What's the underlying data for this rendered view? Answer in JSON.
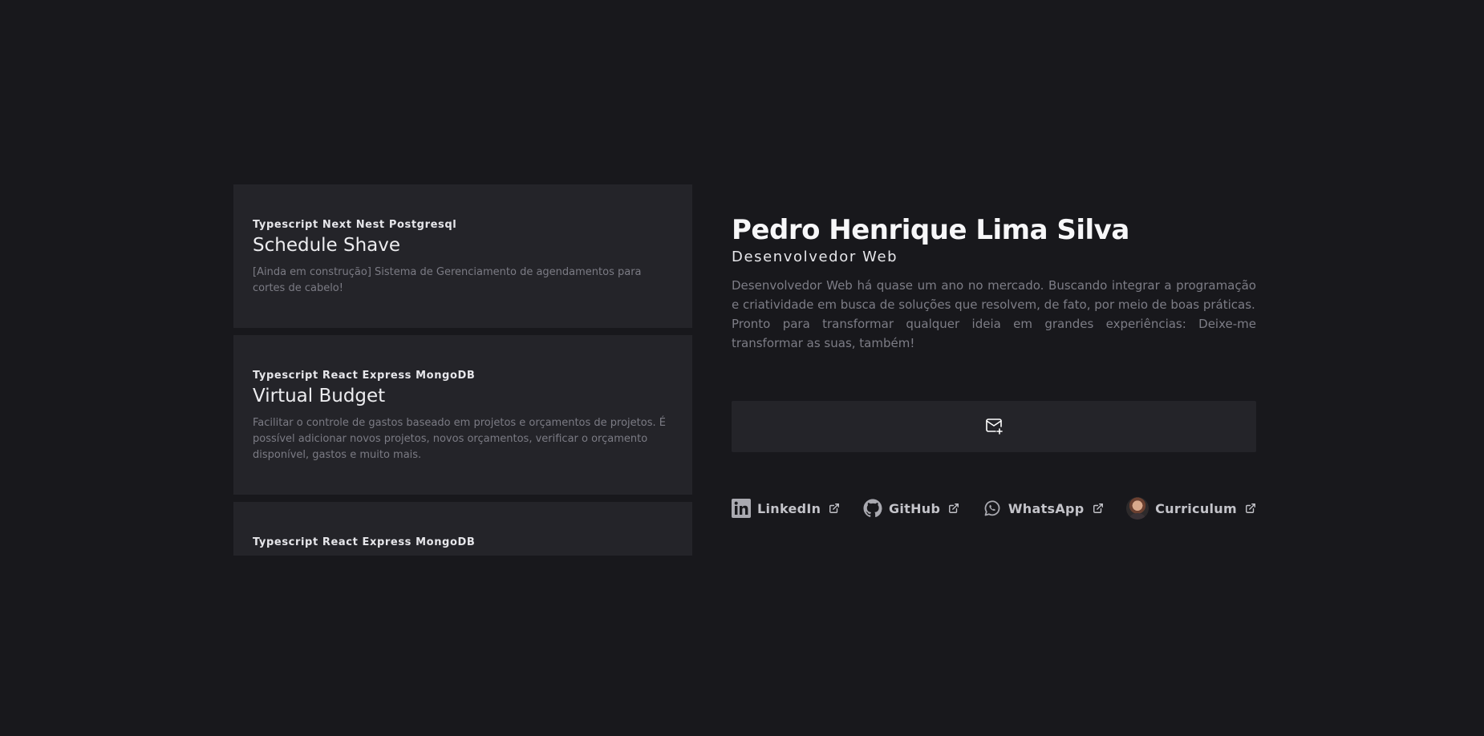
{
  "projects": [
    {
      "tags": "Typescript Next Nest Postgresql",
      "title": "Schedule Shave",
      "description": "[Ainda em construção] Sistema de Gerenciamento de agendamentos para cortes de cabelo!"
    },
    {
      "tags": "Typescript React Express MongoDB",
      "title": "Virtual Budget",
      "description": "Facilitar o controle de gastos baseado em projetos e orçamentos de projetos. É possível adicionar novos projetos, novos orçamentos, verificar o orçamento disponível, gastos e muito mais."
    },
    {
      "tags": "Typescript React Express MongoDB",
      "title": "",
      "description": ""
    }
  ],
  "profile": {
    "name": "Pedro Henrique Lima Silva",
    "role": "Desenvolvedor Web",
    "bio_line1": "Desenvolvedor Web há quase um ano no mercado. Buscando integrar a programação e criatividade em busca de soluções que resolvem, de fato, por meio de boas práticas.",
    "bio_line2": "Pronto para transformar qualquer ideia em grandes experiências: Deixe-me transformar as suas, também!"
  },
  "contact": {
    "icon": "mail-plus-icon"
  },
  "links": [
    {
      "label": "LinkedIn",
      "icon": "linkedin-icon"
    },
    {
      "label": "GitHub",
      "icon": "github-icon"
    },
    {
      "label": "WhatsApp",
      "icon": "whatsapp-icon"
    },
    {
      "label": "Curriculum",
      "icon": "avatar"
    }
  ],
  "colors": {
    "background": "#18181c",
    "card": "#242429",
    "text_primary": "#f7f7f9",
    "text_muted": "#7d7d86"
  }
}
